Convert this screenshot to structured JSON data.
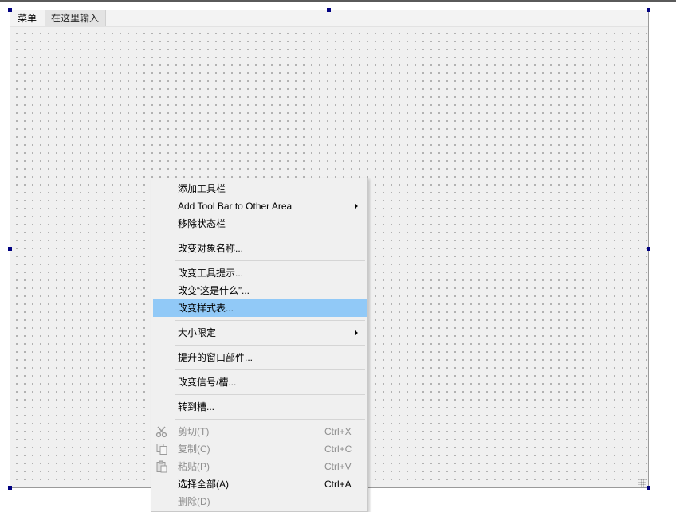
{
  "menubar": {
    "items": [
      "菜单",
      "在这里输入"
    ]
  },
  "context_menu": {
    "add_toolbar": "添加工具栏",
    "add_toolbar_other_area": "Add Tool Bar to Other Area",
    "remove_statusbar": "移除状态栏",
    "change_object_name": "改变对象名称...",
    "change_tooltip": "改变工具提示...",
    "change_whatsthis": "改变“这是什么”...",
    "change_stylesheet": "改变样式表...",
    "size_constraints": "大小限定",
    "promote_to": "提升的窗口部件...",
    "change_signals_slots": "改变信号/槽...",
    "go_to_slot": "转到槽...",
    "cut": {
      "label": "剪切(T)",
      "shortcut": "Ctrl+X"
    },
    "copy": {
      "label": "复制(C)",
      "shortcut": "Ctrl+C"
    },
    "paste": {
      "label": "粘贴(P)",
      "shortcut": "Ctrl+V"
    },
    "select_all": {
      "label": "选择全部(A)",
      "shortcut": "Ctrl+A"
    },
    "delete": {
      "label": "删除(D)"
    }
  },
  "colors": {
    "highlight": "#91c9f7",
    "handle": "#000080",
    "disabled_text": "#8e8e8e"
  }
}
